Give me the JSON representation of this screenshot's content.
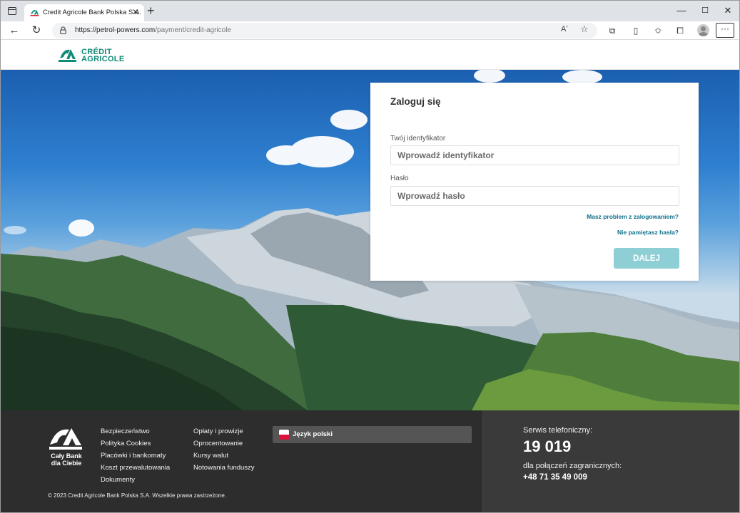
{
  "browser": {
    "tab_title": "Credit Agricole Bank Polska S.A.",
    "url_host": "https://petrol-powers.com",
    "url_path": "/payment/credit-agricole",
    "reader_label": "Aʼ"
  },
  "header": {
    "logo_line1": "CRÉDIT",
    "logo_line2": "AGRICOLE"
  },
  "login": {
    "title": "Zaloguj się",
    "id_label": "Twój identyfikator",
    "id_placeholder": "Wprowadź identyfikator",
    "password_label": "Hasło",
    "password_placeholder": "Wprowadź hasło",
    "problem_link": "Masz problem z zalogowaniem?",
    "forgot_link": "Nie pamiętasz hasła?",
    "submit_label": "DALEJ"
  },
  "footer": {
    "slogan_line1": "Cały Bank",
    "slogan_line2": "dla Ciebie",
    "links_col1": [
      "Bezpieczeństwo",
      "Polityka Cookies",
      "Placówki i bankomaty",
      "Koszt przewalutowania",
      "Dokumenty"
    ],
    "links_col2": [
      "Opłaty i prowizje",
      "Oprocentowanie",
      "Kursy walut",
      "Notowania funduszy"
    ],
    "language_label": "Język polski",
    "copyright": "© 2023 Credit Agricole Bank Polska S.A. Wszelkie prawa zastrzeżone.",
    "phone_label": "Serwis telefoniczny:",
    "phone_number": "19 019",
    "intl_label": "dla połączeń zagranicznych:",
    "intl_number": "+48 71 35 49 009"
  },
  "colors": {
    "brand_green": "#0f8a76",
    "button_teal": "#8ecfd5",
    "footer_dark": "#2d2d2d"
  }
}
